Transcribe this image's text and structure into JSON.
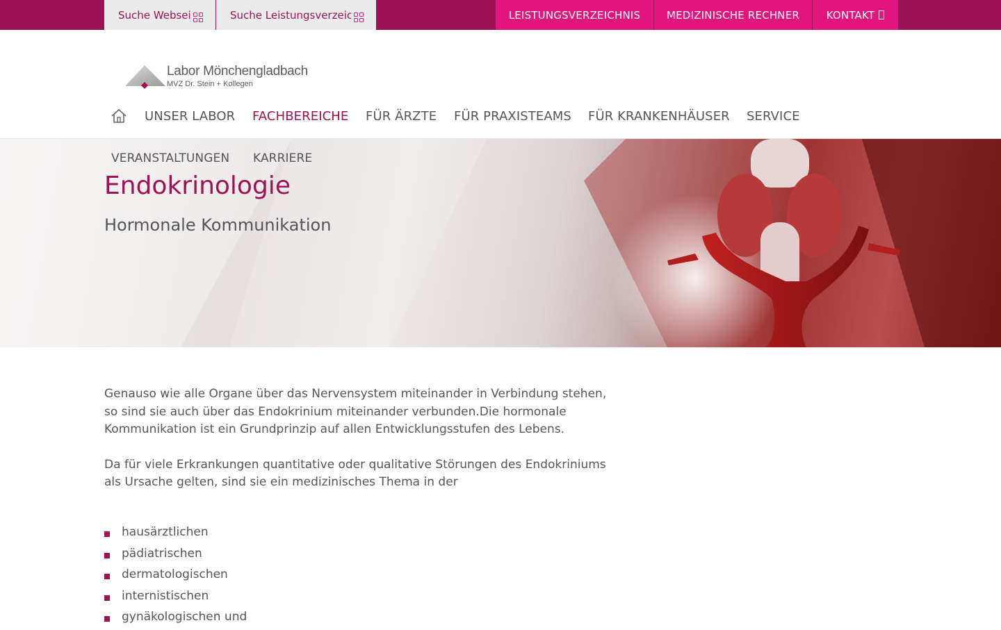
{
  "colors": {
    "brand": "#9b1256",
    "accent": "#e2157e",
    "search_bg": "#ebebeb",
    "text": "#555555"
  },
  "topbar": {
    "search_web_placeholder": "Suche Webseite",
    "search_lv_placeholder": "Suche Leistungsverzeichnis",
    "search_icon": "grid-icon",
    "links": [
      {
        "label": "LEISTUNGSVERZEICHNIS"
      },
      {
        "label": "MEDIZINISCHE RECHNER"
      },
      {
        "label": "KONTAKT",
        "icon": "box-icon"
      }
    ]
  },
  "logo": {
    "main": "Labor Mönchengladbach",
    "sub": "MVZ Dr. Stein + Kollegen"
  },
  "mainnav": {
    "home_icon": "home-icon",
    "items": [
      {
        "label": "UNSER LABOR"
      },
      {
        "label": "FACHBEREICHE",
        "active": true
      },
      {
        "label": "FÜR ÄRZTE"
      },
      {
        "label": "FÜR PRAXISTEAMS"
      },
      {
        "label": "FÜR KRANKENHÄUSER"
      },
      {
        "label": "SERVICE"
      },
      {
        "label": "VERANSTALTUNGEN"
      },
      {
        "label": "KARRIERE"
      }
    ]
  },
  "hero": {
    "title": "Endokrinologie",
    "subtitle": "Hormonale Kommunikation"
  },
  "content": {
    "paragraphs": [
      "Genauso wie alle Organe über das Nervensystem miteinander in Verbindung stehen, so sind sie auch über das Endokrinium miteinander verbunden.Die hormonale Kommunikation ist ein Grundprinzip auf allen Entwicklungsstufen des Lebens.",
      "Da für viele Erkrankungen quantitative oder qualitative Störungen des Endokriniums als Ursache gelten, sind sie ein medizinisches Thema in der"
    ],
    "bullets": [
      "hausärztlichen",
      "pädiatrischen",
      "dermatologischen",
      "internistischen",
      "gynäkologischen und"
    ]
  }
}
